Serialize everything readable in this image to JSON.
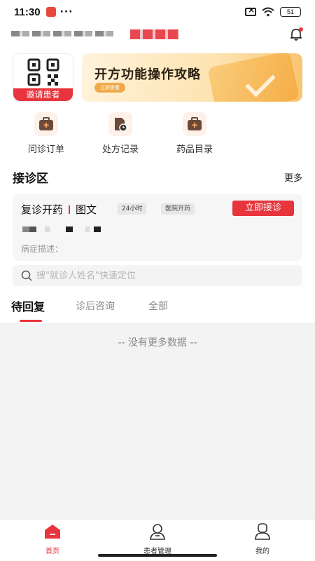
{
  "status_bar": {
    "time": "11:30",
    "more": "···",
    "battery": "51"
  },
  "header": {},
  "qr_card": {
    "label": "邀请患者"
  },
  "banner": {
    "title": "开方功能操作攻略",
    "button_label": "立即查看"
  },
  "quick_actions": [
    {
      "label": "问诊订单",
      "icon": "consult-order-icon"
    },
    {
      "label": "处方记录",
      "icon": "prescription-record-icon"
    },
    {
      "label": "药品目录",
      "icon": "drug-catalog-icon"
    }
  ],
  "section": {
    "title": "接诊区",
    "more": "更多"
  },
  "consult_card": {
    "type": "复诊开药",
    "mode": "图文",
    "tags": [
      "24小时",
      "医院开药"
    ],
    "accept_label": "立即接诊",
    "symptom_label": "病症描述："
  },
  "search": {
    "placeholder": "搜\"就诊人姓名\"快速定位"
  },
  "tabs": [
    {
      "label": "待回复",
      "active": true
    },
    {
      "label": "诊后咨询",
      "active": false
    },
    {
      "label": "全部",
      "active": false
    }
  ],
  "list": {
    "empty_text": "-- 没有更多数据 --"
  },
  "bottom_nav": [
    {
      "label": "首页",
      "active": true
    },
    {
      "label": "患者管理",
      "active": false
    },
    {
      "label": "我的",
      "active": false
    }
  ],
  "colors": {
    "accent": "#e8343c",
    "banner": "#fde3b0",
    "list_bg": "#f3f3f3"
  }
}
